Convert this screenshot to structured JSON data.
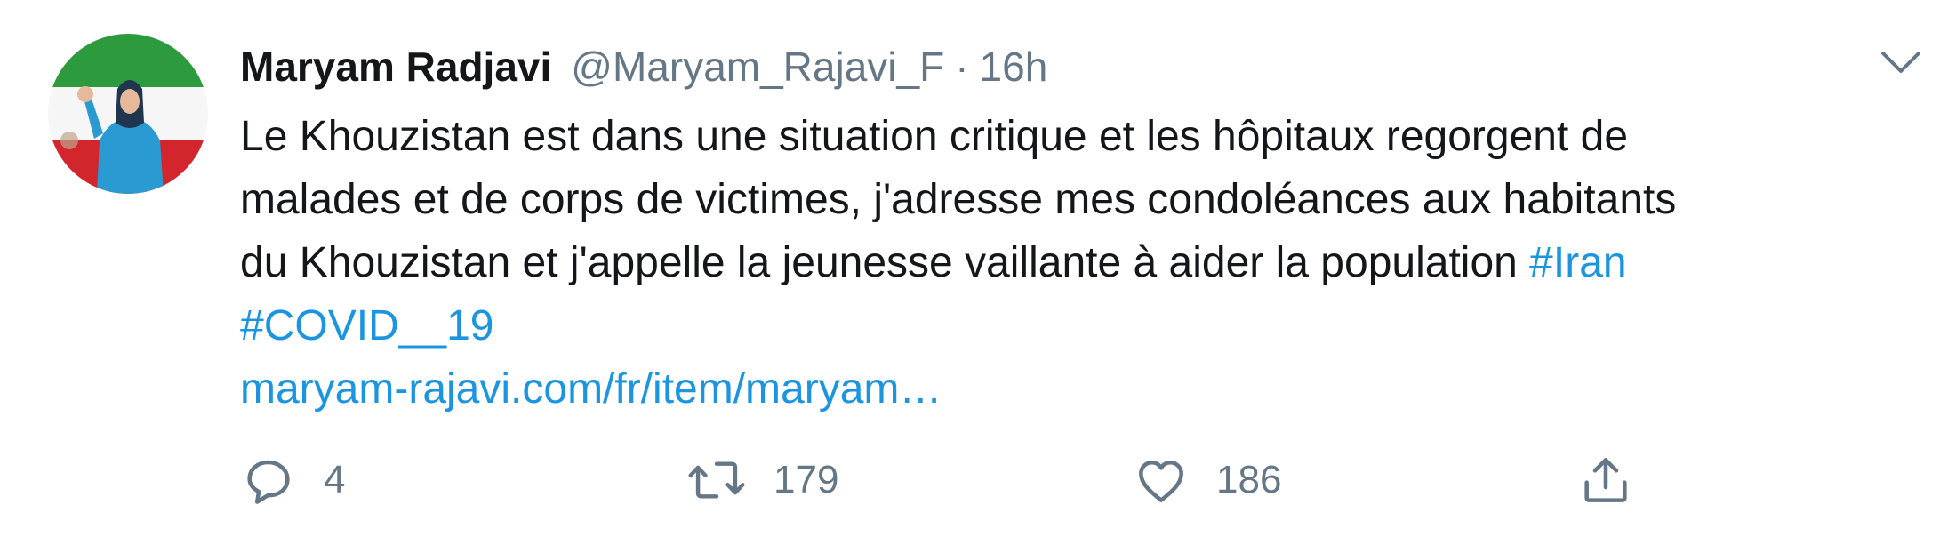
{
  "tweet": {
    "author_name": "Maryam Radjavi",
    "author_handle": "@Maryam_Rajavi_F",
    "separator": "·",
    "time": "16h",
    "text_lines": [
      "Le Khouzistan est dans une situation critique et les hôpitaux regorgent de",
      "malades et de corps de victimes, j'adresse mes condoléances aux habitants",
      "du Khouzistan et j'appelle la jeunesse vaillante à aider la population "
    ],
    "hashtag_iran": "#Iran",
    "hashtag_covid": "#COVID__19",
    "url": "maryam-rajavi.com/fr/item/maryam…"
  },
  "actions": {
    "reply_count": "4",
    "retweet_count": "179",
    "like_count": "186"
  },
  "colors": {
    "link": "#1b95e0",
    "secondary": "#657786",
    "primary": "#14171a"
  },
  "icons": {
    "more": "chevron-down-icon",
    "reply": "reply-icon",
    "retweet": "retweet-icon",
    "like": "heart-icon",
    "share": "share-icon"
  }
}
